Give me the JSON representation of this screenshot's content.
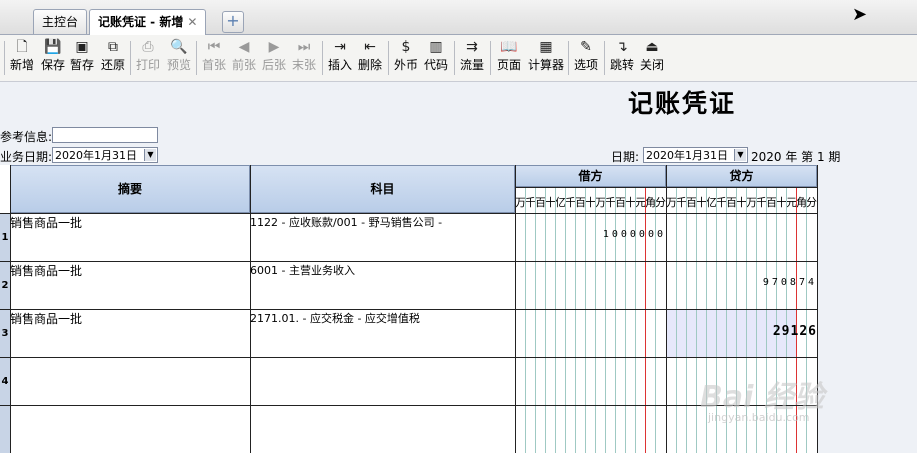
{
  "tabs": [
    {
      "label": "主控台"
    },
    {
      "label": "记账凭证 - 新增",
      "close": "✕"
    }
  ],
  "tab_add": "+",
  "toolbar": [
    {
      "label": "新增",
      "icon": "🗋",
      "enabled": true
    },
    {
      "label": "保存",
      "icon": "💾",
      "enabled": true
    },
    {
      "label": "暂存",
      "icon": "▣",
      "enabled": true
    },
    {
      "label": "还原",
      "icon": "⧉",
      "enabled": true
    },
    {
      "label": "打印",
      "icon": "⎙",
      "enabled": false
    },
    {
      "label": "预览",
      "icon": "🔍",
      "enabled": false
    },
    {
      "label": "首张",
      "icon": "⏮",
      "enabled": false
    },
    {
      "label": "前张",
      "icon": "◀",
      "enabled": false
    },
    {
      "label": "后张",
      "icon": "▶",
      "enabled": false
    },
    {
      "label": "末张",
      "icon": "⏭",
      "enabled": false
    },
    {
      "label": "插入",
      "icon": "⇥",
      "enabled": true
    },
    {
      "label": "删除",
      "icon": "⇤",
      "enabled": true
    },
    {
      "label": "外币",
      "icon": "$",
      "enabled": true
    },
    {
      "label": "代码",
      "icon": "▥",
      "enabled": true
    },
    {
      "label": "流量",
      "icon": "⇉",
      "enabled": true
    },
    {
      "label": "页面",
      "icon": "📖",
      "enabled": true
    },
    {
      "label": "计算器",
      "icon": "▦",
      "enabled": true
    },
    {
      "label": "选项",
      "icon": "✎",
      "enabled": true
    },
    {
      "label": "跳转",
      "icon": "↴",
      "enabled": true
    },
    {
      "label": "关闭",
      "icon": "⏏",
      "enabled": true
    }
  ],
  "voucher": {
    "title": "记账凭证",
    "ref_label": "参考信息:",
    "ref_value": "",
    "biz_date_label": "业务日期:",
    "biz_date": "2020年1月31日",
    "date_label": "日期:",
    "date": "2020年1月31日",
    "period": "2020 年 第 1 期"
  },
  "grid": {
    "col_summary": "摘要",
    "col_account": "科目",
    "col_debit": "借方",
    "col_credit": "贷方",
    "digit_header": "万千百十亿千百十万千百十元角分",
    "rows": [
      {
        "num": "1",
        "summary": "销售商品一批",
        "account": "1122 - 应收账款/001 - 野马销售公司 -",
        "debit": "1000000",
        "credit": ""
      },
      {
        "num": "2",
        "summary": "销售商品一批",
        "account": "6001 - 主营业务收入",
        "debit": "",
        "credit": "970874"
      },
      {
        "num": "3",
        "summary": "销售商品一批",
        "account": "2171.01.    - 应交税金 - 应交增值税",
        "debit": "",
        "credit": "29126"
      },
      {
        "num": "4",
        "summary": "",
        "account": "",
        "debit": "",
        "credit": ""
      },
      {
        "num": "",
        "summary": "",
        "account": "",
        "debit": "",
        "credit": ""
      }
    ]
  },
  "watermark": "Bai 经验",
  "watermark_sub": "jingyan.baidu.com"
}
